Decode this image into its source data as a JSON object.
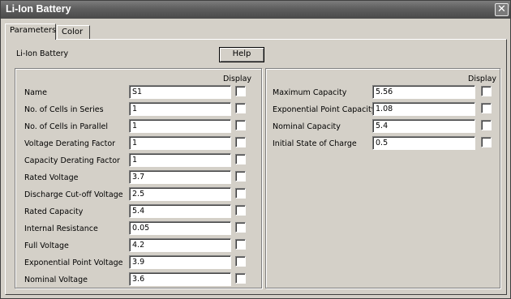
{
  "window": {
    "title": "Li-Ion Battery",
    "close_glyph": "✕"
  },
  "tabs": [
    {
      "label": "Parameters",
      "active": true
    },
    {
      "label": "Color",
      "active": false
    }
  ],
  "panel": {
    "block_name": "Li-Ion Battery",
    "help_label": "Help",
    "display_header": "Display"
  },
  "left_group": [
    {
      "label": "Name",
      "value": "S1",
      "display": false
    },
    {
      "label": "No. of Cells in Series",
      "value": "1",
      "display": false
    },
    {
      "label": "No. of Cells in Parallel",
      "value": "1",
      "display": false
    },
    {
      "label": "Voltage Derating Factor",
      "value": "1",
      "display": false
    },
    {
      "label": "Capacity Derating Factor",
      "value": "1",
      "display": false
    },
    {
      "label": "Rated Voltage",
      "value": "3.7",
      "display": false
    },
    {
      "label": "Discharge Cut-off Voltage",
      "value": "2.5",
      "display": false
    },
    {
      "label": "Rated Capacity",
      "value": "5.4",
      "display": false
    },
    {
      "label": "Internal Resistance",
      "value": "0.05",
      "display": false
    },
    {
      "label": "Full Voltage",
      "value": "4.2",
      "display": false
    },
    {
      "label": "Exponential Point Voltage",
      "value": "3.9",
      "display": false
    },
    {
      "label": "Nominal Voltage",
      "value": "3.6",
      "display": false
    }
  ],
  "right_group": [
    {
      "label": "Maximum Capacity",
      "value": "5.56",
      "display": false
    },
    {
      "label": "Exponential Point Capacity",
      "value": "1.08",
      "display": false
    },
    {
      "label": "Nominal Capacity",
      "value": "5.4",
      "display": false
    },
    {
      "label": "Initial State of Charge",
      "value": "0.5",
      "display": false
    }
  ]
}
